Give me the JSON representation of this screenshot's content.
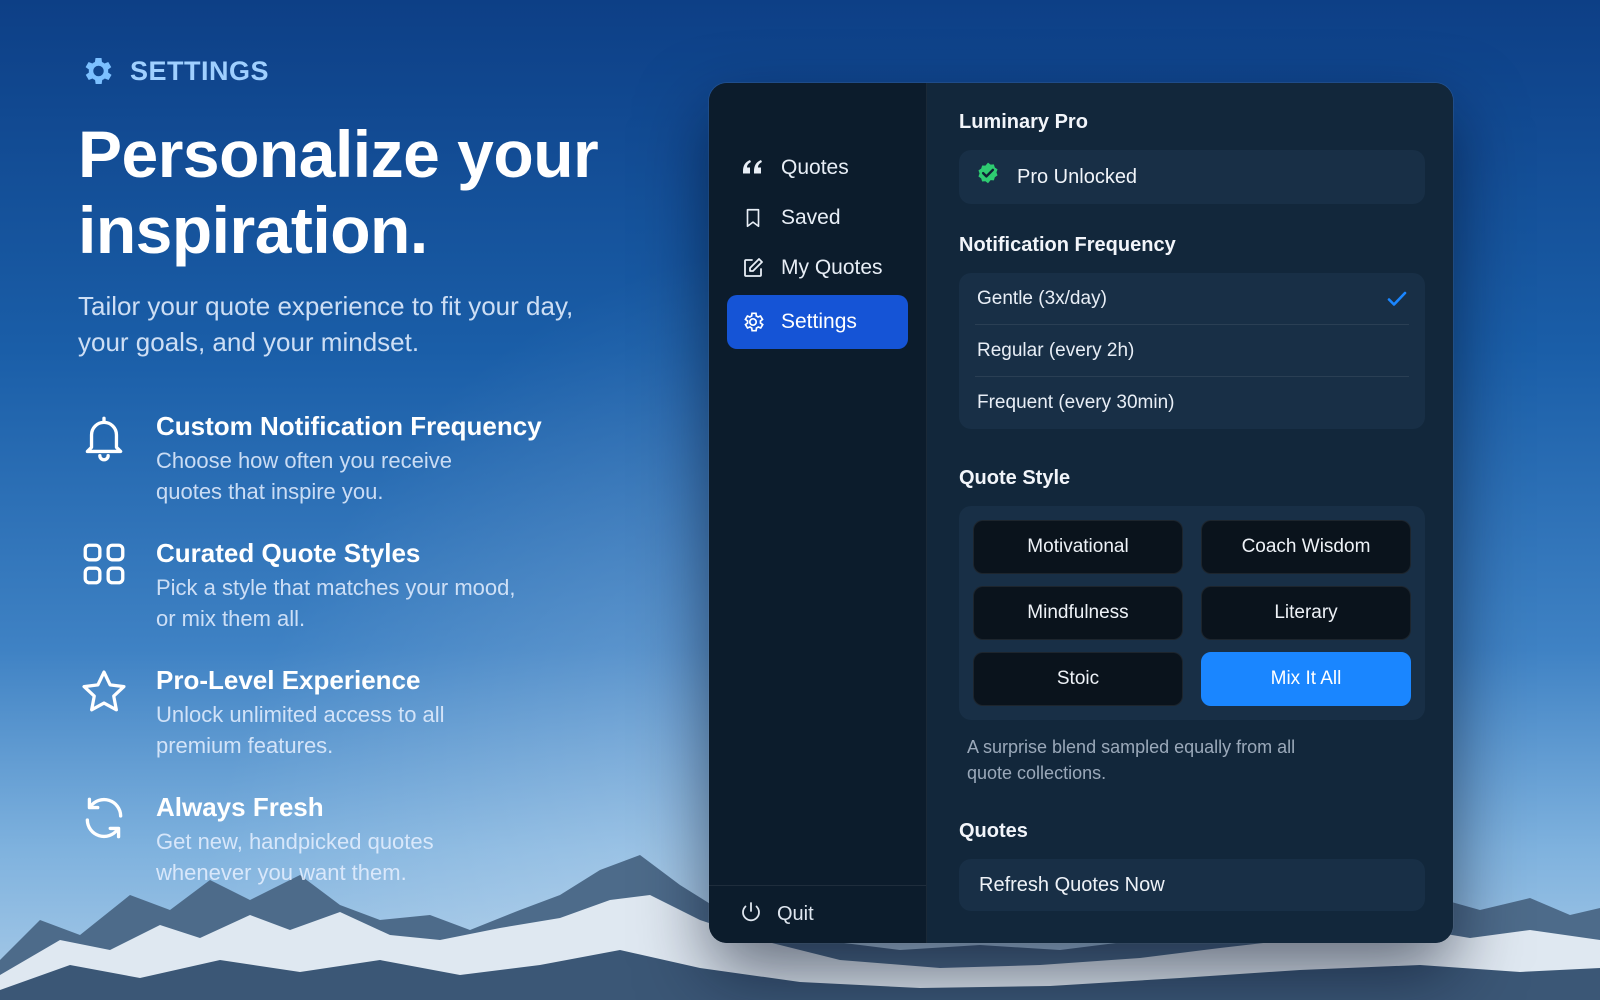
{
  "colors": {
    "accent_blue": "#1a86ff",
    "sidebar_active": "#1554d6",
    "eyebrow": "#9fd0ff",
    "pro_badge": "#2ecc71"
  },
  "promo": {
    "eyebrow_icon": "gear-icon",
    "eyebrow": "SETTINGS",
    "headline_line1": "Personalize your",
    "headline_line2": "inspiration.",
    "subhead": "Tailor your quote experience to fit your day, your goals, and your mindset.",
    "features": [
      {
        "icon": "bell-icon",
        "title": "Custom Notification Frequency",
        "desc": "Choose how often you receive quotes that inspire you."
      },
      {
        "icon": "grid-icon",
        "title": "Curated Quote Styles",
        "desc": "Pick a style that matches your mood, or mix them all."
      },
      {
        "icon": "star-icon",
        "title": "Pro-Level Experience",
        "desc": "Unlock unlimited access to all premium features."
      },
      {
        "icon": "refresh-icon",
        "title": "Always Fresh",
        "desc": "Get new, handpicked quotes whenever you want them."
      }
    ]
  },
  "sidebar": {
    "items": [
      {
        "icon": "quote-icon",
        "label": "Quotes",
        "active": false
      },
      {
        "icon": "bookmark-icon",
        "label": "Saved",
        "active": false
      },
      {
        "icon": "edit-icon",
        "label": "My Quotes",
        "active": false
      },
      {
        "icon": "gear-icon",
        "label": "Settings",
        "active": true
      }
    ],
    "footer": {
      "icon": "power-icon",
      "label": "Quit"
    }
  },
  "content": {
    "pro": {
      "title": "Luminary Pro",
      "status": "Pro Unlocked",
      "icon": "verified-badge-icon"
    },
    "frequency": {
      "title": "Notification Frequency",
      "options": [
        {
          "label": "Gentle (3x/day)",
          "selected": true
        },
        {
          "label": "Regular (every 2h)",
          "selected": false
        },
        {
          "label": "Frequent (every 30min)",
          "selected": false
        }
      ]
    },
    "quote_style": {
      "title": "Quote Style",
      "options": [
        {
          "label": "Motivational",
          "selected": false
        },
        {
          "label": "Coach Wisdom",
          "selected": false
        },
        {
          "label": "Mindfulness",
          "selected": false
        },
        {
          "label": "Literary",
          "selected": false
        },
        {
          "label": "Stoic",
          "selected": false
        },
        {
          "label": "Mix It All",
          "selected": true
        }
      ],
      "note": "A surprise blend sampled equally from all quote collections."
    },
    "quotes": {
      "title": "Quotes",
      "refresh_label": "Refresh Quotes Now"
    }
  }
}
